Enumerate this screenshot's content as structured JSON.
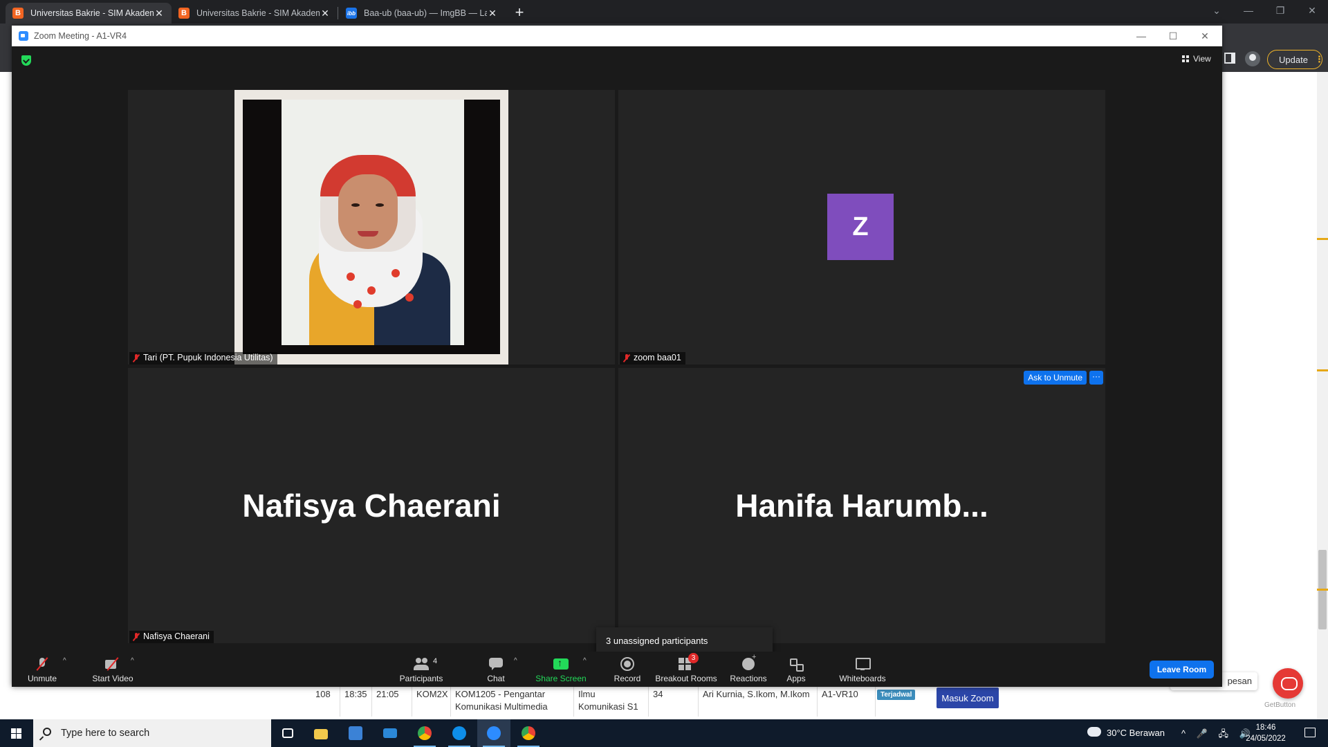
{
  "browser": {
    "tabs": [
      {
        "title": "Universitas Bakrie - SIM Akademik",
        "favicon": "B",
        "active": true
      },
      {
        "title": "Universitas Bakrie - SIM Akademik",
        "favicon": "B",
        "active": false
      },
      {
        "title": "Baa-ub (baa-ub) — ImgBB — Landing",
        "favicon": "ibb",
        "active": false
      }
    ],
    "new_tab": "+",
    "update_label": "Update",
    "update_dots": "⋮"
  },
  "page": {
    "schedule_row": {
      "no": "108",
      "start": "18:35",
      "end": "21:05",
      "class": "KOM2X",
      "course": "KOM1205 - Pengantar Komunikasi Multimedia",
      "program": "Ilmu Komunikasi S1",
      "students": "34",
      "lecturer": "Ari Kurnia, S.Ikom, M.Ikom",
      "room": "A1-VR10",
      "status": "Terjadwal",
      "join_label": "Masuk Zoom"
    },
    "chat_tooltip": "pesan",
    "getbutton": "GetButton"
  },
  "zoom": {
    "window_title": "Zoom Meeting - A1-VR4",
    "view_label": "View",
    "tiles": [
      {
        "name": "Tari (PT. Pupuk Indonesia Utilitas)",
        "type": "video"
      },
      {
        "name": "zoom baa01",
        "type": "avatar",
        "avatar_letter": "Z",
        "avatar_color": "#7f4dbd"
      },
      {
        "name": "Nafisya Chaerani",
        "type": "name",
        "display_name": "Nafisya Chaerani"
      },
      {
        "name": "",
        "type": "name",
        "display_name": "Hanifa  Harumb..."
      }
    ],
    "ask_to_unmute": "Ask to Unmute",
    "more": "···",
    "unassigned_tip": "3 unassigned participants",
    "toolbar": {
      "unmute": "Unmute",
      "start_video": "Start Video",
      "participants": "Participants",
      "participants_count": "4",
      "chat": "Chat",
      "share_screen": "Share Screen",
      "record": "Record",
      "breakout_rooms": "Breakout Rooms",
      "breakout_badge": "3",
      "reactions": "Reactions",
      "apps": "Apps",
      "whiteboards": "Whiteboards",
      "leave_room": "Leave Room"
    },
    "colors": {
      "accent": "#0e72ed",
      "share_green": "#23d959",
      "muted_red": "#e02828"
    }
  },
  "taskbar": {
    "search_placeholder": "Type here to search",
    "weather": "30°C  Berawan",
    "tray_icons": "^ 🎤 🖧 🔊",
    "time": "18:46",
    "date": "24/05/2022"
  }
}
